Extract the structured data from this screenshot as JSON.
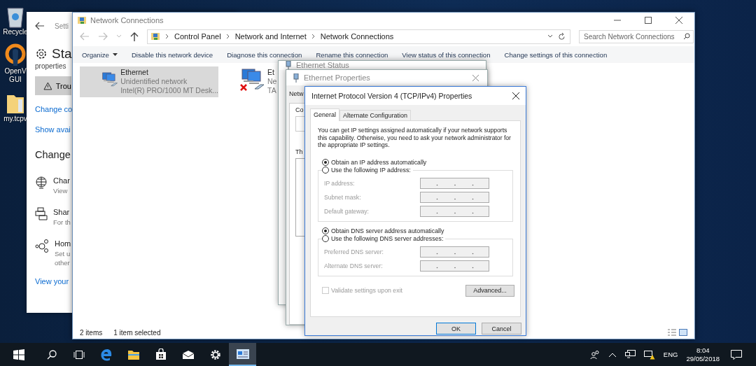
{
  "desktop_icons": [
    {
      "kind": "recycle",
      "lines": [
        "Recycle"
      ]
    },
    {
      "kind": "vpn",
      "lines": [
        "OpenV",
        "GUI"
      ]
    },
    {
      "kind": "folder",
      "lines": [
        "my.tcpv"
      ]
    }
  ],
  "settings_window": {
    "title": "Setti",
    "heading": "Sta",
    "subtext": "properties",
    "troubleshoot_button": "Trou",
    "links": [
      "Change co",
      "Show avai"
    ],
    "section_title": "Change",
    "items": [
      {
        "kind": "globe",
        "title": "Char",
        "lines": [
          "View"
        ]
      },
      {
        "kind": "printer",
        "title": "Shar",
        "lines": [
          "For th"
        ]
      },
      {
        "kind": "homegroup",
        "title": "Hom",
        "lines": [
          "Set u",
          "other"
        ]
      }
    ],
    "footer_link": "View your"
  },
  "explorer": {
    "title": "Network Connections",
    "breadcrumb": [
      "Control Panel",
      "Network and Internet",
      "Network Connections"
    ],
    "search": {
      "placeholder": "Search Network Connections"
    },
    "toolbar": [
      {
        "label": "Organize",
        "kind": "menu"
      },
      {
        "label": "Disable this network device",
        "kind": "command"
      },
      {
        "label": "Diagnose this connection",
        "kind": "command"
      },
      {
        "label": "Rename this connection",
        "kind": "command"
      },
      {
        "label": "View status of this connection",
        "kind": "command"
      },
      {
        "label": "Change settings of this connection",
        "kind": "command"
      }
    ],
    "items": [
      {
        "name": "Ethernet",
        "lines": [
          "Unidentified network",
          "Intel(R) PRO/1000 MT Desk..."
        ],
        "selected": true,
        "disconnected": false
      },
      {
        "name": "Et",
        "lines": [
          "Ne",
          "TA"
        ],
        "selected": false,
        "disconnected": true
      }
    ],
    "status_bar": [
      "2 items",
      "1 item selected"
    ]
  },
  "ethernet_status": {
    "title": "Ethernet Status"
  },
  "ethernet_properties": {
    "title": "Ethernet Properties",
    "fragments": [
      "Netw",
      "Co",
      "Th"
    ]
  },
  "ipv4_dialog": {
    "title": "Internet Protocol Version 4 (TCP/IPv4) Properties",
    "tabs": [
      {
        "label": "General",
        "selected": true
      },
      {
        "label": "Alternate Configuration",
        "selected": false
      }
    ],
    "description": "You can get IP settings assigned automatically if your network supports this capability. Otherwise, you need to ask your network administrator for the appropriate IP settings.",
    "groups": [
      {
        "auto_option": {
          "label": "Obtain an IP address automatically",
          "selected": true
        },
        "manual_option": {
          "label": "Use the following IP address:",
          "selected": false
        },
        "fields": [
          {
            "label": "IP address:",
            "disabled": true
          },
          {
            "label": "Subnet mask:",
            "disabled": true
          },
          {
            "label": "Default gateway:",
            "disabled": true
          }
        ]
      },
      {
        "auto_option": {
          "label": "Obtain DNS server address automatically",
          "selected": true
        },
        "manual_option": {
          "label": "Use the following DNS server addresses:",
          "selected": false
        },
        "fields": [
          {
            "label": "Preferred DNS server:",
            "disabled": true
          },
          {
            "label": "Alternate DNS server:",
            "disabled": true
          }
        ]
      }
    ],
    "validate": {
      "label": "Validate settings upon exit",
      "checked": false,
      "disabled": true
    },
    "advanced_button": "Advanced...",
    "ok_button": "OK",
    "cancel_button": "Cancel"
  },
  "taskbar": {
    "apps": [
      {
        "kind": "search",
        "active": false
      },
      {
        "kind": "taskview",
        "active": false
      },
      {
        "kind": "edge",
        "active": false
      },
      {
        "kind": "explorer",
        "active": false
      },
      {
        "kind": "store",
        "active": false
      },
      {
        "kind": "mail",
        "active": false
      },
      {
        "kind": "settings",
        "active": false
      },
      {
        "kind": "network",
        "active": true
      }
    ],
    "language": "ENG",
    "time": "8:04",
    "date": "29/05/2018"
  }
}
